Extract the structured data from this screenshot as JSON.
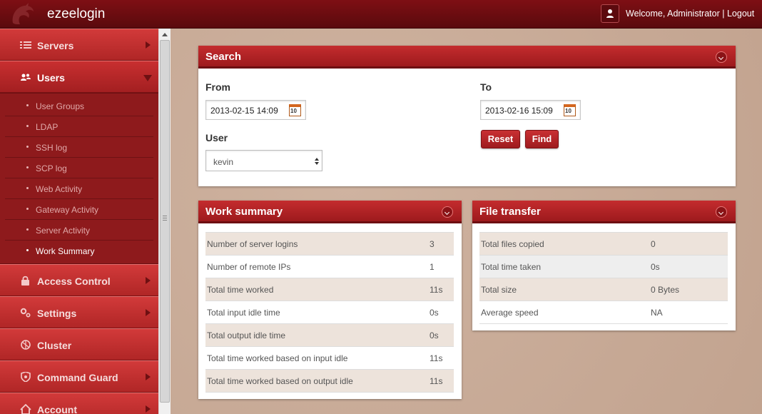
{
  "header": {
    "brand": "ezeelogin",
    "welcome_text": "Welcome, Administrator",
    "separator": " | ",
    "logout_label": "Logout"
  },
  "sidebar": {
    "items": [
      {
        "label": "Servers",
        "icon": "list-icon"
      },
      {
        "label": "Users",
        "icon": "users-icon",
        "expanded": true
      },
      {
        "label": "Access Control",
        "icon": "lock-icon"
      },
      {
        "label": "Settings",
        "icon": "gears-icon"
      },
      {
        "label": "Cluster",
        "icon": "cluster-icon"
      },
      {
        "label": "Command Guard",
        "icon": "shield-icon"
      },
      {
        "label": "Account",
        "icon": "home-icon"
      }
    ],
    "sub_items": [
      {
        "label": "User Groups"
      },
      {
        "label": "LDAP"
      },
      {
        "label": "SSH log"
      },
      {
        "label": "SCP log"
      },
      {
        "label": "Web Activity"
      },
      {
        "label": "Gateway Activity"
      },
      {
        "label": "Server Activity"
      },
      {
        "label": "Work Summary",
        "active": true
      }
    ]
  },
  "search": {
    "title": "Search",
    "from_label": "From",
    "from_value": "2013-02-15 14:09",
    "to_label": "To",
    "to_value": "2013-02-16 15:09",
    "user_label": "User",
    "user_value": "kevin",
    "calendar_day": "10",
    "reset_label": "Reset",
    "find_label": "Find"
  },
  "work_summary": {
    "title": "Work summary",
    "rows": [
      {
        "label": "Number of server logins",
        "value": "3"
      },
      {
        "label": "Number of remote IPs",
        "value": "1"
      },
      {
        "label": "Total time worked",
        "value": "11s"
      },
      {
        "label": "Total input idle time",
        "value": "0s"
      },
      {
        "label": "Total output idle time",
        "value": "0s"
      },
      {
        "label": "Total time worked based on input idle",
        "value": "11s"
      },
      {
        "label": "Total time worked based on output idle",
        "value": "11s"
      }
    ]
  },
  "file_transfer": {
    "title": "File transfer",
    "rows": [
      {
        "label": "Total files copied",
        "value": "0"
      },
      {
        "label": "Total time taken",
        "value": "0s"
      },
      {
        "label": "Total size",
        "value": "0 Bytes"
      },
      {
        "label": "Average speed",
        "value": "NA"
      }
    ]
  },
  "colors": {
    "topbar": "#6b0c10",
    "sidebar": "#b62828",
    "accent": "#c42c2e",
    "row_stripe": "#ede3db"
  }
}
